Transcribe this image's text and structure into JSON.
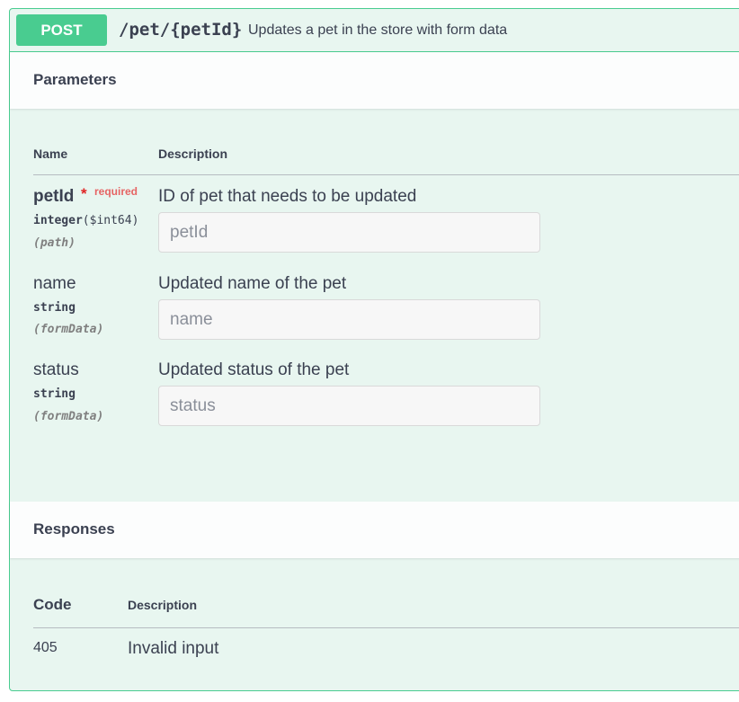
{
  "operation": {
    "method": "POST",
    "path": "/pet/{petId}",
    "summary": "Updates a pet in the store with form data"
  },
  "parameters": {
    "title": "Parameters",
    "col_name": "Name",
    "col_description": "Description",
    "items": [
      {
        "name": "petId",
        "required_star": "*",
        "required_label": "required",
        "type": "integer",
        "format": "($int64)",
        "in": "(path)",
        "description": "ID of pet that needs to be updated",
        "placeholder": "petId"
      },
      {
        "name": "name",
        "type": "string",
        "in": "(formData)",
        "description": "Updated name of the pet",
        "placeholder": "name"
      },
      {
        "name": "status",
        "type": "string",
        "in": "(formData)",
        "description": "Updated status of the pet",
        "placeholder": "status"
      }
    ]
  },
  "responses": {
    "title": "Responses",
    "col_code": "Code",
    "col_description": "Description",
    "items": [
      {
        "code": "405",
        "description": "Invalid input"
      }
    ]
  },
  "colors": {
    "post_accent": "#49cc90",
    "block_bg": "#e8f6f0",
    "required": "#e02424"
  }
}
